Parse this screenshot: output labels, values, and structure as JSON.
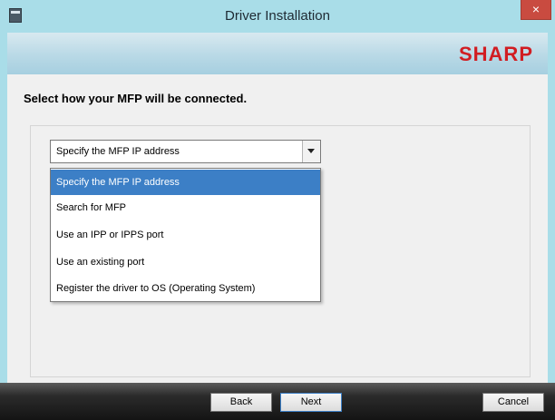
{
  "window": {
    "title": "Driver Installation",
    "close_symbol": "×",
    "icon": "installer-icon"
  },
  "banner": {
    "logo_text": "SHARP"
  },
  "main": {
    "heading": "Select how your MFP will be connected.",
    "connection_select": {
      "selected": "Specify the MFP IP address",
      "options": [
        "Specify the MFP IP address",
        "Search for MFP",
        "Use an IPP or IPPS port",
        "Use an existing port",
        "Register the driver to OS (Operating System)"
      ]
    }
  },
  "footer": {
    "back_label": "Back",
    "next_label": "Next",
    "cancel_label": "Cancel"
  },
  "colors": {
    "titlebar": "#a9dde8",
    "logo": "#d11d22",
    "selection": "#3c7fc6",
    "close": "#c94b40"
  }
}
